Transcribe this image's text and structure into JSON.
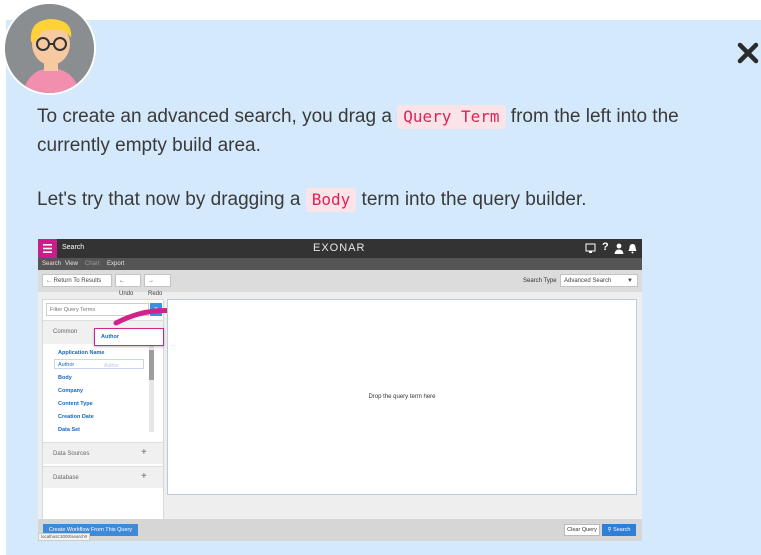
{
  "message": {
    "line1_before": "To create an advanced search, you drag a",
    "line1_code": "Query Term",
    "line1_after": "from the left into the",
    "line2": "currently empty build area.",
    "line3_before": "Let's try that now by dragging a",
    "line3_code": "Body",
    "line3_after": "term into the query builder."
  },
  "screenshot": {
    "app_section": "Search",
    "logo": "EXONAR",
    "menu": [
      "Search",
      "View",
      "Chart",
      "Export"
    ],
    "toolbar": {
      "return_label": "← Return To Results",
      "undo_label": "← Undo",
      "redo_label": "→ Redo",
      "search_type_label": "Search Type",
      "search_type_value": "Advanced Search"
    },
    "filter_placeholder": "Filter Query Terms",
    "common_label": "Common",
    "drag_label": "Author",
    "terms": [
      "Application Name",
      "Author",
      "Body",
      "Company",
      "Content Type",
      "Creation Date",
      "Data Set"
    ],
    "author_ghost": "Author",
    "data_sources_label": "Data Sources",
    "database_label": "Database",
    "drop_hint": "Drop the query term here",
    "create_workflow_label": "Create Workflow From This Query",
    "url_label": "localhost:3000/search#",
    "clear_query_label": "Clear Query",
    "search_button_label": "Search"
  },
  "colors": {
    "card_background": "#d4e9fb",
    "code_background": "#fbe4e7",
    "code_text": "#e0225a",
    "brand_magenta": "#c81e8c",
    "link_blue": "#1565c0",
    "search_button": "#2f7fd8"
  },
  "icons": {
    "close": "close-icon",
    "avatar": "avatar-illustration",
    "drag_arrow": "curved-arrow-icon"
  }
}
